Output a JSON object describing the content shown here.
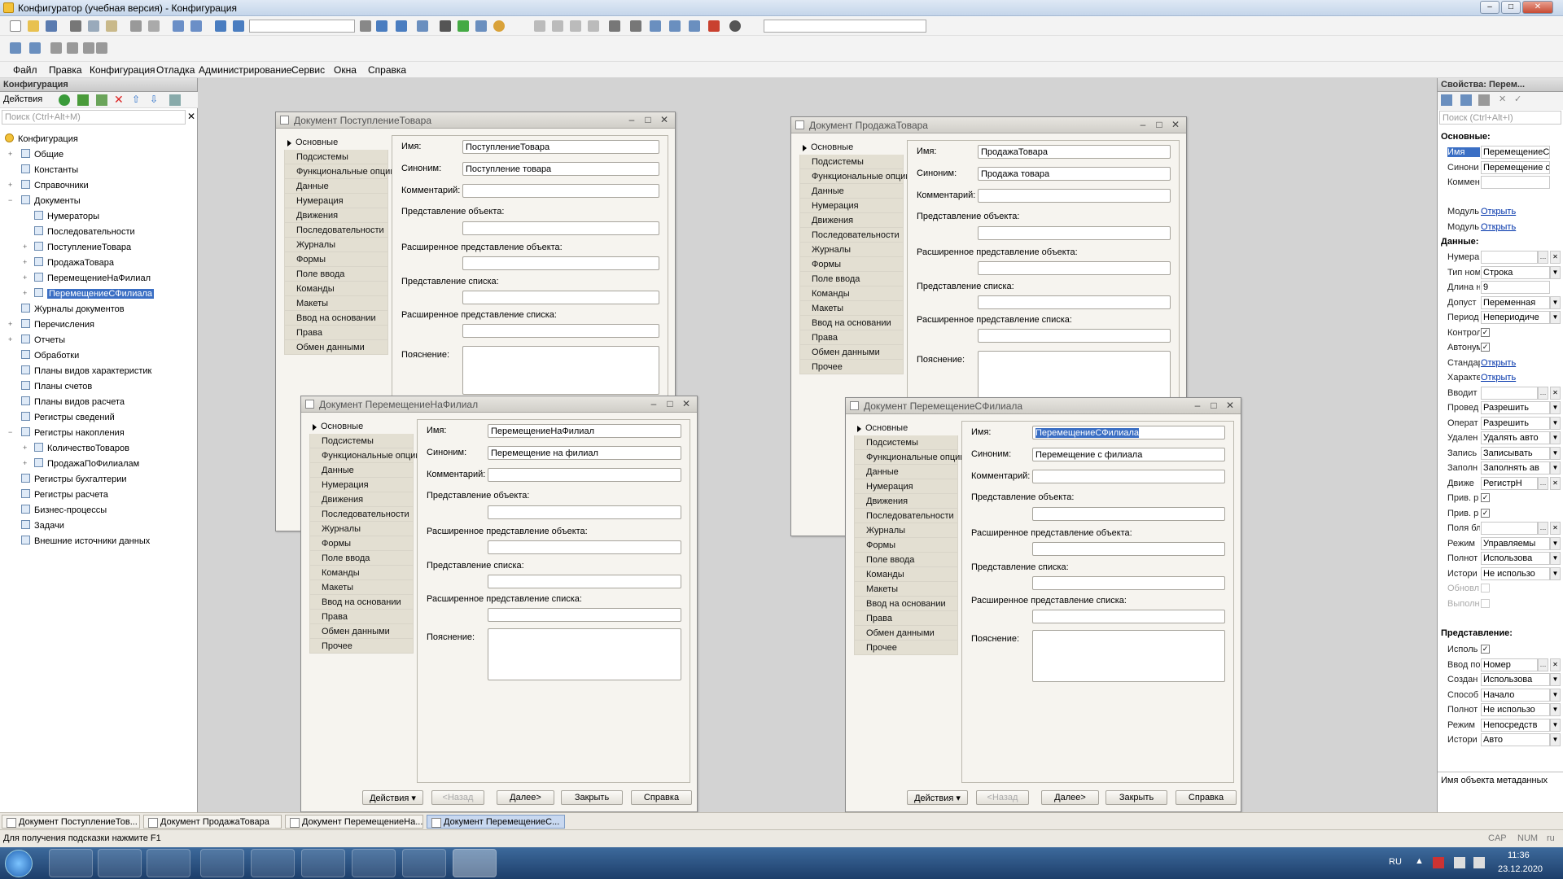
{
  "window": {
    "title": "Конфигуратор (учебная версия) - Конфигурация",
    "minimize": "–",
    "maximize": "□",
    "close": "✕"
  },
  "menu": [
    "Файл",
    "Правка",
    "Конфигурация",
    "Отладка",
    "Администрирование",
    "Сервис",
    "Окна",
    "Справка"
  ],
  "config_panel": {
    "title": "Конфигурация",
    "actions_label": "Действия",
    "search_placeholder": "Поиск (Ctrl+Alt+M)",
    "tree": [
      {
        "label": "Конфигурация",
        "level": 0,
        "icon": "config-icon"
      },
      {
        "label": "Общие",
        "level": 1,
        "icon": "common-icon",
        "exp": "+"
      },
      {
        "label": "Константы",
        "level": 1,
        "icon": "constants-icon"
      },
      {
        "label": "Справочники",
        "level": 1,
        "icon": "catalogs-icon",
        "exp": "+"
      },
      {
        "label": "Документы",
        "level": 1,
        "icon": "documents-icon",
        "exp": "−"
      },
      {
        "label": "Нумераторы",
        "level": 2,
        "icon": "numerators-icon"
      },
      {
        "label": "Последовательности",
        "level": 2,
        "icon": "sequences-icon"
      },
      {
        "label": "ПоступлениеТовара",
        "level": 2,
        "icon": "document-icon",
        "exp": "+"
      },
      {
        "label": "ПродажаТовара",
        "level": 2,
        "icon": "document-icon",
        "exp": "+"
      },
      {
        "label": "ПеремещениеНаФилиал",
        "level": 2,
        "icon": "document-icon",
        "exp": "+"
      },
      {
        "label": "ПеремещениеСФилиала",
        "level": 2,
        "icon": "document-icon",
        "exp": "+",
        "selected": true
      },
      {
        "label": "Журналы документов",
        "level": 1,
        "icon": "journals-icon"
      },
      {
        "label": "Перечисления",
        "level": 1,
        "icon": "enums-icon",
        "exp": "+"
      },
      {
        "label": "Отчеты",
        "level": 1,
        "icon": "reports-icon",
        "exp": "+"
      },
      {
        "label": "Обработки",
        "level": 1,
        "icon": "processing-icon"
      },
      {
        "label": "Планы видов характеристик",
        "level": 1,
        "icon": "chart-char-icon"
      },
      {
        "label": "Планы счетов",
        "level": 1,
        "icon": "chart-accounts-icon"
      },
      {
        "label": "Планы видов расчета",
        "level": 1,
        "icon": "chart-calc-icon"
      },
      {
        "label": "Регистры сведений",
        "level": 1,
        "icon": "info-reg-icon"
      },
      {
        "label": "Регистры накопления",
        "level": 1,
        "icon": "accum-reg-icon",
        "exp": "−"
      },
      {
        "label": "КоличествоТоваров",
        "level": 2,
        "icon": "register-icon",
        "exp": "+"
      },
      {
        "label": "ПродажаПоФилиалам",
        "level": 2,
        "icon": "register-icon",
        "exp": "+"
      },
      {
        "label": "Регистры бухгалтерии",
        "level": 1,
        "icon": "acc-reg-icon"
      },
      {
        "label": "Регистры расчета",
        "level": 1,
        "icon": "calc-reg-icon"
      },
      {
        "label": "Бизнес-процессы",
        "level": 1,
        "icon": "bp-icon"
      },
      {
        "label": "Задачи",
        "level": 1,
        "icon": "tasks-icon"
      },
      {
        "label": "Внешние источники данных",
        "level": 1,
        "icon": "ext-src-icon"
      }
    ]
  },
  "tabs": [
    "Основные",
    "Подсистемы",
    "Функциональные опции",
    "Данные",
    "Нумерация",
    "Движения",
    "Последовательности",
    "Журналы",
    "Формы",
    "Поле ввода",
    "Команды",
    "Макеты",
    "Ввод на основании",
    "Права",
    "Обмен данными",
    "Прочее"
  ],
  "labels": {
    "name": "Имя:",
    "synonym": "Синоним:",
    "comment": "Комментарий:",
    "obj_repr": "Представление объекта:",
    "ext_obj_repr": "Расширенное представление объекта:",
    "list_repr": "Представление списка:",
    "ext_list_repr": "Расширенное представление списка:",
    "explanation": "Пояснение:"
  },
  "buttons": {
    "actions": "Действия",
    "back": "<Назад",
    "next": "Далее>",
    "close": "Закрыть",
    "help": "Справка"
  },
  "docs": [
    {
      "title": "Документ ПоступлениеТовара",
      "name": "ПоступлениеТовара",
      "synonym": "Поступление товара"
    },
    {
      "title": "Документ ПродажаТовара",
      "name": "ПродажаТовара",
      "synonym": "Продажа товара"
    },
    {
      "title": "Документ ПеремещениеНаФилиал",
      "name": "ПеремещениеНаФилиал",
      "synonym": "Перемещение на филиал"
    },
    {
      "title": "Документ ПеремещениеСФилиала",
      "name": "ПеремещениеСФилиала",
      "synonym": "Перемещение с филиала"
    }
  ],
  "props": {
    "title": "Свойства: Перем...",
    "search_placeholder": "Поиск (Ctrl+Alt+I)",
    "sec_main": "Основные:",
    "sec_data": "Данные:",
    "sec_repr": "Представление:",
    "rows": [
      {
        "l": "Имя",
        "v": "ПеремещениеС",
        "t": "val",
        "hl": true
      },
      {
        "l": "Синони",
        "v": "Перемещение с",
        "t": "val"
      },
      {
        "l": "Коммен",
        "v": "",
        "t": "val"
      },
      {
        "l": "Модуль",
        "v": "Открыть",
        "t": "link"
      },
      {
        "l": "Модуль",
        "v": "Открыть",
        "t": "link"
      },
      {
        "l": "Нумера",
        "v": "",
        "t": "dd",
        "x": "✕"
      },
      {
        "l": "Тип ном",
        "v": "Строка",
        "t": "dd"
      },
      {
        "l": "Длина н",
        "v": "9",
        "t": "val"
      },
      {
        "l": "Допуст",
        "v": "Переменная",
        "t": "dd"
      },
      {
        "l": "Период",
        "v": "Непериодиче",
        "t": "dd"
      },
      {
        "l": "Контрол",
        "v": "✓",
        "t": "chk"
      },
      {
        "l": "Автонум",
        "v": "✓",
        "t": "chk"
      },
      {
        "l": "Стандар",
        "v": "Открыть",
        "t": "link"
      },
      {
        "l": "Характе",
        "v": "Открыть",
        "t": "link"
      },
      {
        "l": "Вводит",
        "v": "",
        "t": "dd",
        "x": "✕"
      },
      {
        "l": "Провед",
        "v": "Разрешить",
        "t": "dd"
      },
      {
        "l": "Операт",
        "v": "Разрешить",
        "t": "dd"
      },
      {
        "l": "Удален",
        "v": "Удалять авто",
        "t": "dd"
      },
      {
        "l": "Запись",
        "v": "Записывать",
        "t": "dd"
      },
      {
        "l": "Заполн",
        "v": "Заполнять ав",
        "t": "dd"
      },
      {
        "l": "Движе",
        "v": "РегистрН",
        "t": "dd",
        "x": "✕"
      },
      {
        "l": "Прив. р",
        "v": "✓",
        "t": "chk"
      },
      {
        "l": "Прив. р",
        "v": "✓",
        "t": "chk"
      },
      {
        "l": "Поля бл",
        "v": "",
        "t": "dd",
        "x": "✕"
      },
      {
        "l": "Режим",
        "v": "Управляемы",
        "t": "dd"
      },
      {
        "l": "Полнот",
        "v": "Использова",
        "t": "dd"
      },
      {
        "l": "Истори",
        "v": "Не использо",
        "t": "dd"
      },
      {
        "l": "Обновл",
        "v": "",
        "t": "chk",
        "dis": true
      },
      {
        "l": "Выполн",
        "v": "",
        "t": "chk",
        "dis": true
      },
      {
        "l": "Исполь",
        "v": "✓",
        "t": "chk"
      },
      {
        "l": "Ввод по",
        "v": "Номер",
        "t": "dd",
        "x": "✕"
      },
      {
        "l": "Создан",
        "v": "Использова",
        "t": "dd"
      },
      {
        "l": "Способ",
        "v": "Начало",
        "t": "dd"
      },
      {
        "l": "Полнот",
        "v": "Не использо",
        "t": "dd"
      },
      {
        "l": "Режим",
        "v": "Непосредств",
        "t": "dd"
      },
      {
        "l": "Истори",
        "v": "Авто",
        "t": "dd"
      }
    ],
    "hint": "Имя объекта метаданных"
  },
  "window_tabs": [
    "Документ ПоступлениеТов...",
    "Документ ПродажаТовара",
    "Документ ПеремещениеНа...",
    "Документ ПеремещениеС..."
  ],
  "status": {
    "hint": "Для получения подсказки нажмите F1",
    "cap": "CAP",
    "num": "NUM",
    "ru": "ru"
  },
  "taskbar": {
    "lang": "RU",
    "time": "11:36",
    "date": "23.12.2020"
  }
}
